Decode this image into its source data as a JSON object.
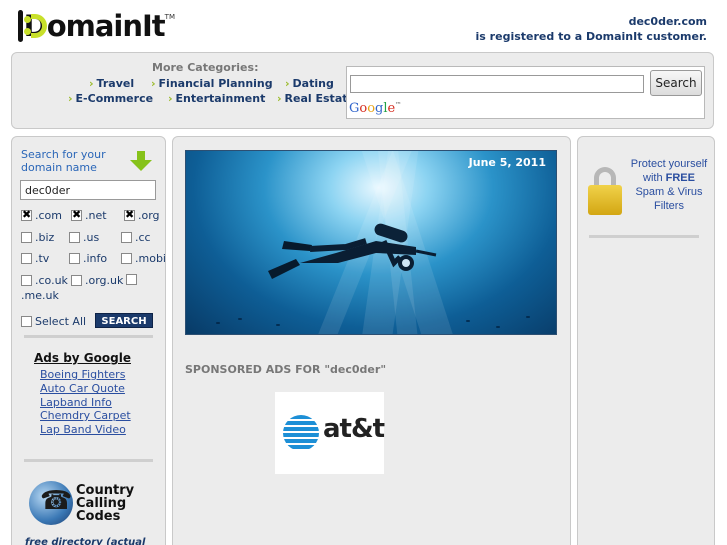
{
  "header": {
    "logo_text": "DomainIt",
    "logo_tm": "TM",
    "domain": "dec0der.com",
    "registered_text": "is registered to a DomainIt customer."
  },
  "categories": {
    "title": "More Categories:",
    "items": [
      "Travel",
      "Financial Planning",
      "Dating",
      "E-Commerce",
      "Entertainment",
      "Real Estate"
    ]
  },
  "search": {
    "value": "",
    "button_label": "Search",
    "provider": "Google"
  },
  "domain_search": {
    "title": "Search for your domain name",
    "input_value": "dec0der",
    "tlds": [
      {
        "label": ".com",
        "checked": true
      },
      {
        "label": ".net",
        "checked": true
      },
      {
        "label": ".org",
        "checked": true
      },
      {
        "label": ".biz",
        "checked": false
      },
      {
        "label": ".us",
        "checked": false
      },
      {
        "label": ".cc",
        "checked": false
      },
      {
        "label": ".tv",
        "checked": false
      },
      {
        "label": ".info",
        "checked": false
      },
      {
        "label": ".mobi",
        "checked": false
      },
      {
        "label": ".co.uk",
        "checked": false
      },
      {
        "label": ".org.uk",
        "checked": false
      },
      {
        "label": ".me.uk",
        "checked": false
      }
    ],
    "select_all_label": "Select All",
    "search_button_label": "SEARCH"
  },
  "ads": {
    "title": "Ads by Google",
    "links": [
      "Boeing Fighters",
      "Auto Car Quote",
      "Lapband Info",
      "Chemdry Carpet",
      "Lap Band Video"
    ]
  },
  "country_codes": {
    "line1": "Country",
    "line2": "Calling",
    "line3": "Codes",
    "icon": "phone-globe-icon"
  },
  "free_directory": "free directory (actual",
  "hero": {
    "date": "June 5, 2011"
  },
  "sponsored": {
    "heading": "SPONSORED ADS FOR \"dec0der\"",
    "brand": "at&t"
  },
  "protect": {
    "line1": "Protect yourself",
    "line2": "with",
    "line2b": "FREE",
    "line3": "Spam & Virus",
    "line4": "Filters"
  }
}
